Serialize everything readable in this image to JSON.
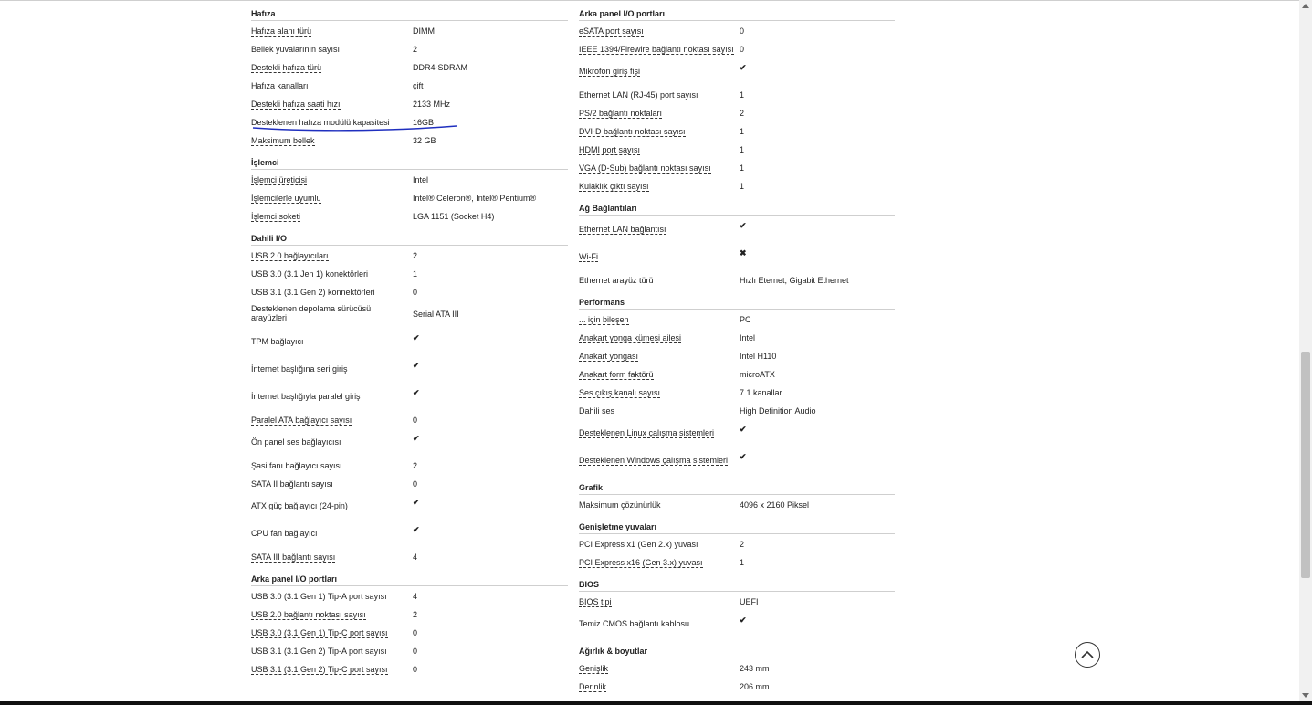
{
  "left_column": [
    {
      "title": "Hafıza",
      "rows": [
        {
          "name": "Hafıza alanı türü",
          "value": "DIMM",
          "dotted": true
        },
        {
          "name": "Bellek yuvalarının sayısı",
          "value": "2",
          "dotted": false
        },
        {
          "name": "Destekli hafıza türü",
          "value": "DDR4-SDRAM",
          "dotted": true
        },
        {
          "name": "Hafıza kanalları",
          "value": "çift",
          "dotted": false
        },
        {
          "name": "Destekli hafıza saati hızı",
          "value": "2133 MHz",
          "dotted": true
        },
        {
          "name": "Desteklenen hafıza modülü kapasitesi",
          "value": "16GB",
          "dotted": false
        },
        {
          "name": "Maksimum bellek",
          "value": "32 GB",
          "dotted": true
        }
      ]
    },
    {
      "title": "İşlemci",
      "rows": [
        {
          "name": "İşlemci üreticisi",
          "value": "Intel",
          "dotted": true
        },
        {
          "name": "İşlemcilerle uyumlu",
          "value": "Intel® Celeron®, Intel® Pentium®",
          "dotted": true
        },
        {
          "name": "İşlemci soketi",
          "value": "LGA 1151 (Socket H4)",
          "dotted": true
        }
      ]
    },
    {
      "title": "Dahili I/O",
      "rows": [
        {
          "name": "USB 2.0 bağlayıcıları",
          "value": "2",
          "dotted": true
        },
        {
          "name": "USB 3.0 (3.1 Jen 1) konektörleri",
          "value": "1",
          "dotted": true
        },
        {
          "name": "USB 3.1 (3.1 Gen 2) konnektörleri",
          "value": "0",
          "dotted": false
        },
        {
          "name": "Desteklenen depolama sürücüsü arayüzleri",
          "value": "Serial ATA III",
          "dotted": false,
          "tall": true,
          "twoline": true
        },
        {
          "name": "TPM bağlayıcı",
          "icon": "check",
          "dotted": false,
          "tall": true
        },
        {
          "name": "İnternet başlığına seri giriş",
          "icon": "check",
          "dotted": false,
          "tall": true
        },
        {
          "name": "İnternet başlığıyla paralel giriş",
          "icon": "check",
          "dotted": false,
          "tall": true
        },
        {
          "name": "Paralel ATA bağlayıcı sayısı",
          "value": "0",
          "dotted": true
        },
        {
          "name": "Ön panel ses bağlayıcısı",
          "icon": "check",
          "dotted": false,
          "tall": true
        },
        {
          "name": "Şasi fanı bağlayıcı sayısı",
          "value": "2",
          "dotted": false
        },
        {
          "name": "SATA II bağlantı sayısı",
          "value": "0",
          "dotted": true
        },
        {
          "name": "ATX güç bağlayıcı (24-pin)",
          "icon": "check",
          "dotted": false,
          "tall": true
        },
        {
          "name": "CPU fan bağlayıcı",
          "icon": "check",
          "dotted": false,
          "tall": true
        },
        {
          "name": "SATA III bağlantı sayısı",
          "value": "4",
          "dotted": true
        }
      ]
    },
    {
      "title": "Arka panel I/O portları",
      "rows": [
        {
          "name": "USB 3.0 (3.1 Gen 1) Tip-A port sayısı",
          "value": "4",
          "dotted": false
        },
        {
          "name": "USB 2.0 bağlantı noktası sayısı",
          "value": "2",
          "dotted": true
        },
        {
          "name": "USB 3.0 (3.1 Gen 1) Tip-C port sayısı",
          "value": "0",
          "dotted": true
        },
        {
          "name": "USB 3.1 (3.1 Gen 2) Tip-A port sayısı",
          "value": "0",
          "dotted": false
        },
        {
          "name": "USB 3.1 (3.1 Gen 2) Tip-C port sayısı",
          "value": "0",
          "dotted": true
        }
      ]
    }
  ],
  "right_column": [
    {
      "title": "Arka panel I/O portları",
      "rows": [
        {
          "name": "eSATA port sayısı",
          "value": "0",
          "dotted": true
        },
        {
          "name": "IEEE 1394/Firewire bağlantı noktası sayısı",
          "value": "0",
          "dotted": true
        },
        {
          "name": "Mikrofon giriş fişi",
          "icon": "check",
          "dotted": true,
          "tall": true
        },
        {
          "name": "Ethernet LAN (RJ-45) port sayısı",
          "value": "1",
          "dotted": true
        },
        {
          "name": "PS/2 bağlantı noktaları",
          "value": "2",
          "dotted": true
        },
        {
          "name": "DVI-D bağlantı noktası sayısı",
          "value": "1",
          "dotted": true
        },
        {
          "name": "HDMI port sayısı",
          "value": "1",
          "dotted": true
        },
        {
          "name": "VGA (D-Sub) bağlantı noktası sayısı",
          "value": "1",
          "dotted": true
        },
        {
          "name": "Kulaklık çıktı sayısı",
          "value": "1",
          "dotted": true
        }
      ]
    },
    {
      "title": "Ağ Bağlantıları",
      "rows": [
        {
          "name": "Ethernet LAN bağlantısı",
          "icon": "check",
          "dotted": true,
          "tall": true
        },
        {
          "name": "Wi-Fi",
          "icon": "cross",
          "dotted": true,
          "tall": true
        },
        {
          "name": "Ethernet arayüz türü",
          "value": "Hızlı Eternet, Gigabit Ethernet",
          "dotted": false
        }
      ]
    },
    {
      "title": "Performans",
      "rows": [
        {
          "name": "... için bileşen",
          "value": "PC",
          "dotted": true
        },
        {
          "name": "Anakart yonga kümesi ailesi",
          "value": "Intel",
          "dotted": true
        },
        {
          "name": "Anakart yongası",
          "value": "Intel H110",
          "dotted": true
        },
        {
          "name": "Anakart form faktörü",
          "value": "microATX",
          "dotted": true
        },
        {
          "name": "Ses çıkış kanalı sayısı",
          "value": "7.1 kanallar",
          "dotted": true
        },
        {
          "name": "Dahili ses",
          "value": "High Definition Audio",
          "dotted": true
        },
        {
          "name": "Desteklenen Linux çalışma sistemleri",
          "icon": "check",
          "dotted": true,
          "tall": true
        },
        {
          "name": "Desteklenen Windows çalışma sistemleri",
          "icon": "check",
          "dotted": true,
          "tall": true
        }
      ]
    },
    {
      "title": "Grafik",
      "rows": [
        {
          "name": "Maksimum çözünürlük",
          "value": "4096 x 2160 Piksel",
          "dotted": true
        }
      ]
    },
    {
      "title": "Genişletme yuvaları",
      "rows": [
        {
          "name": "PCI Express x1 (Gen 2.x) yuvası",
          "value": "2",
          "dotted": false
        },
        {
          "name": "PCI Express x16 (Gen 3.x) yuvası",
          "value": "1",
          "dotted": true
        }
      ]
    },
    {
      "title": "BIOS",
      "rows": [
        {
          "name": "BIOS tipi",
          "value": "UEFI",
          "dotted": true
        },
        {
          "name": "Temiz CMOS bağlantı kablosu",
          "icon": "check",
          "dotted": false,
          "tall": true
        }
      ]
    },
    {
      "title": "Ağırlık & boyutlar",
      "rows": [
        {
          "name": "Genişlik",
          "value": "243 mm",
          "dotted": true
        },
        {
          "name": "Derinlik",
          "value": "206 mm",
          "dotted": true
        }
      ]
    }
  ],
  "icons": {
    "check": "✔",
    "cross": "✖"
  },
  "colors": {
    "check": "#1aa34a",
    "cross": "#e23a3a",
    "annotation": "#1f2fbf"
  },
  "controls": {
    "scroll_top_icon": "chevron-up-icon"
  }
}
